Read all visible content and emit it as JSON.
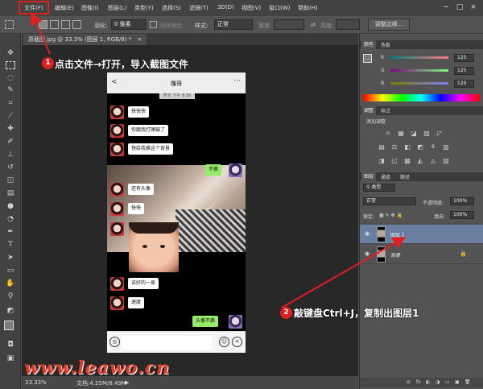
{
  "menubar": {
    "items": [
      "文件(F)",
      "编辑(E)",
      "图像(I)",
      "图层(L)",
      "类型(Y)",
      "选择(S)",
      "滤镜(T)",
      "3D(D)",
      "视图(V)",
      "窗口(W)",
      "帮助(H)"
    ],
    "window_controls": [
      "−",
      "□",
      "×"
    ]
  },
  "options": {
    "feather_label": "羽化:",
    "feather_value": "0 像素",
    "antialias_label": "消除锯齿",
    "style_label": "样式:",
    "style_value": "正常",
    "width_label": "宽度:",
    "height_label": "高度:",
    "adjust_edge": "调整边缘..."
  },
  "document": {
    "tab_title": "原截图.jpg @ 33.3% (图层 1, RGB/8) *",
    "tab_close": "×"
  },
  "status": {
    "zoom": "33.33%",
    "doc_size": "文档:4.25M/8.49M"
  },
  "chat": {
    "title": "雕哥",
    "back": "<",
    "more": "···",
    "time": "昨天 下午 8:38",
    "messages": [
      "快快快",
      "你跟我打赌输了",
      "快给我换这个背景",
      "不换",
      "还有头像",
      "快快",
      "说好的一周",
      "速度",
      "头像不换"
    ],
    "input_icons": [
      "◎",
      "☺",
      "+"
    ]
  },
  "panels": {
    "color_tabs": [
      "颜色",
      "色板"
    ],
    "rgb_labels": [
      "R",
      "G",
      "B"
    ],
    "rgb_values": [
      "125",
      "125",
      "125"
    ],
    "adjust_tabs": [
      "调整",
      "样式"
    ],
    "adjust_title": "添加调整",
    "adj_icons": [
      "☼",
      "▦",
      "◪",
      "▨",
      "◸",
      "▤",
      "⚖",
      "◧",
      "◩",
      "⚘",
      "▥",
      "◨",
      "◱",
      "▩",
      "◭",
      "◬",
      "▧"
    ],
    "layers_tabs": [
      "图层",
      "通道",
      "路径"
    ],
    "filter_kind": "类型",
    "blend_mode": "正常",
    "opacity_label": "不透明度:",
    "opacity_value": "100%",
    "lock_label": "锁定:",
    "fill_label": "填充:",
    "fill_value": "100%",
    "layers": [
      {
        "name": "图层 1"
      },
      {
        "name": "背景"
      }
    ],
    "layer_footer_icons": [
      "⊖",
      "fx",
      "◐",
      "◑",
      "▭",
      "▣",
      "🗑"
    ]
  },
  "annotations": {
    "step1_num": "1",
    "step1": "点击文件→打开，导入截图文件",
    "step2_num": "2",
    "step2": "敲键盘Ctrl+J，复制出图层1"
  },
  "watermark": "www.leawo.cn"
}
